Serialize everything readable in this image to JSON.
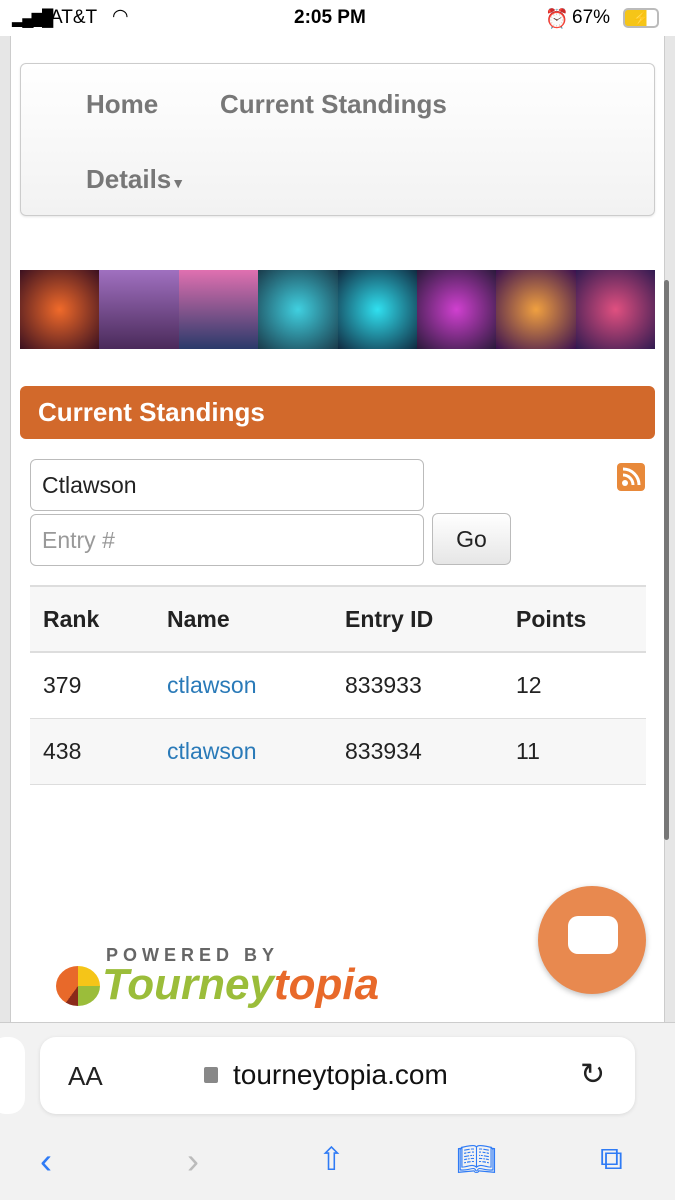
{
  "status": {
    "carrier": "AT&T",
    "time": "2:05 PM",
    "battery": "67%"
  },
  "nav": {
    "home": "Home",
    "standings": "Current Standings",
    "details": "Details"
  },
  "banner": {
    "colors": [
      "#3a1020",
      "#6a3a7a",
      "#2a3a6a",
      "#1a4a5a",
      "#102a40",
      "#2a1a3a",
      "#3a1050",
      "#301a50"
    ]
  },
  "header": {
    "title": "Current Standings",
    "color": "#d2692b"
  },
  "search": {
    "name_value": "Ctlawson",
    "entry_placeholder": "Entry #",
    "go": "Go"
  },
  "table": {
    "columns": [
      "Rank",
      "Name",
      "Entry ID",
      "Points"
    ],
    "rows": [
      {
        "rank": "379",
        "name": "ctlawson",
        "entry": "833933",
        "points": "12"
      },
      {
        "rank": "438",
        "name": "ctlawson",
        "entry": "833934",
        "points": "11"
      }
    ]
  },
  "footer": {
    "powered": "POWERED BY",
    "logo_a": "Tourney",
    "logo_b": "topia"
  },
  "browser": {
    "aa": "AA",
    "url": "tourneytopia.com"
  }
}
